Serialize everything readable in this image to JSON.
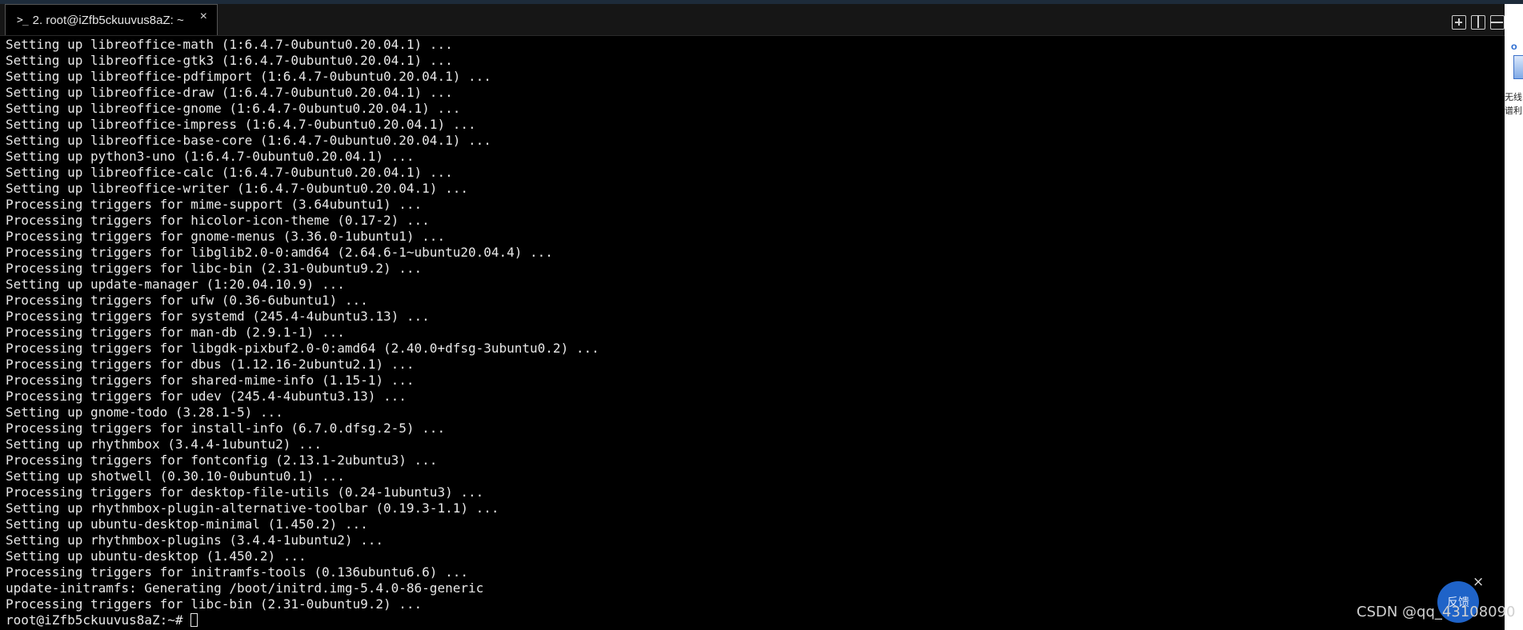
{
  "window": {
    "tab_prompt_glyph": ">_",
    "tab_title": "2. root@iZfb5ckuuvus8aZ: ~",
    "tab_close_glyph": "×"
  },
  "terminal": {
    "lines": [
      "Setting up libreoffice-math (1:6.4.7-0ubuntu0.20.04.1) ...",
      "Setting up libreoffice-gtk3 (1:6.4.7-0ubuntu0.20.04.1) ...",
      "Setting up libreoffice-pdfimport (1:6.4.7-0ubuntu0.20.04.1) ...",
      "Setting up libreoffice-draw (1:6.4.7-0ubuntu0.20.04.1) ...",
      "Setting up libreoffice-gnome (1:6.4.7-0ubuntu0.20.04.1) ...",
      "Setting up libreoffice-impress (1:6.4.7-0ubuntu0.20.04.1) ...",
      "Setting up libreoffice-base-core (1:6.4.7-0ubuntu0.20.04.1) ...",
      "Setting up python3-uno (1:6.4.7-0ubuntu0.20.04.1) ...",
      "Setting up libreoffice-calc (1:6.4.7-0ubuntu0.20.04.1) ...",
      "Setting up libreoffice-writer (1:6.4.7-0ubuntu0.20.04.1) ...",
      "Processing triggers for mime-support (3.64ubuntu1) ...",
      "Processing triggers for hicolor-icon-theme (0.17-2) ...",
      "Processing triggers for gnome-menus (3.36.0-1ubuntu1) ...",
      "Processing triggers for libglib2.0-0:amd64 (2.64.6-1~ubuntu20.04.4) ...",
      "Processing triggers for libc-bin (2.31-0ubuntu9.2) ...",
      "Setting up update-manager (1:20.04.10.9) ...",
      "Processing triggers for ufw (0.36-6ubuntu1) ...",
      "Processing triggers for systemd (245.4-4ubuntu3.13) ...",
      "Processing triggers for man-db (2.9.1-1) ...",
      "Processing triggers for libgdk-pixbuf2.0-0:amd64 (2.40.0+dfsg-3ubuntu0.2) ...",
      "Processing triggers for dbus (1.12.16-2ubuntu2.1) ...",
      "Processing triggers for shared-mime-info (1.15-1) ...",
      "Processing triggers for udev (245.4-4ubuntu3.13) ...",
      "Setting up gnome-todo (3.28.1-5) ...",
      "Processing triggers for install-info (6.7.0.dfsg.2-5) ...",
      "Setting up rhythmbox (3.4.4-1ubuntu2) ...",
      "Processing triggers for fontconfig (2.13.1-2ubuntu3) ...",
      "Setting up shotwell (0.30.10-0ubuntu0.1) ...",
      "Processing triggers for desktop-file-utils (0.24-1ubuntu3) ...",
      "Setting up rhythmbox-plugin-alternative-toolbar (0.19.3-1.1) ...",
      "Setting up ubuntu-desktop-minimal (1.450.2) ...",
      "Setting up rhythmbox-plugins (3.4.4-1ubuntu2) ...",
      "Setting up ubuntu-desktop (1.450.2) ...",
      "Processing triggers for initramfs-tools (0.136ubuntu6.6) ...",
      "update-initramfs: Generating /boot/initrd.img-5.4.0-86-generic",
      "Processing triggers for libc-bin (2.31-0ubuntu9.2) ..."
    ],
    "prompt": "root@iZfb5ckuuvus8aZ:~# "
  },
  "side_panel": {
    "label_top": "O",
    "text_line_1": "无线",
    "text_line_2": "谱利"
  },
  "overlay": {
    "feedback_label": "反馈",
    "feedback_close_glyph": "×",
    "watermark": "CSDN @qq_43108090"
  },
  "icons": {
    "new_tab": "plus-square-icon",
    "split_vertical": "split-vertical-icon",
    "split_horizontal": "split-horizontal-icon"
  }
}
